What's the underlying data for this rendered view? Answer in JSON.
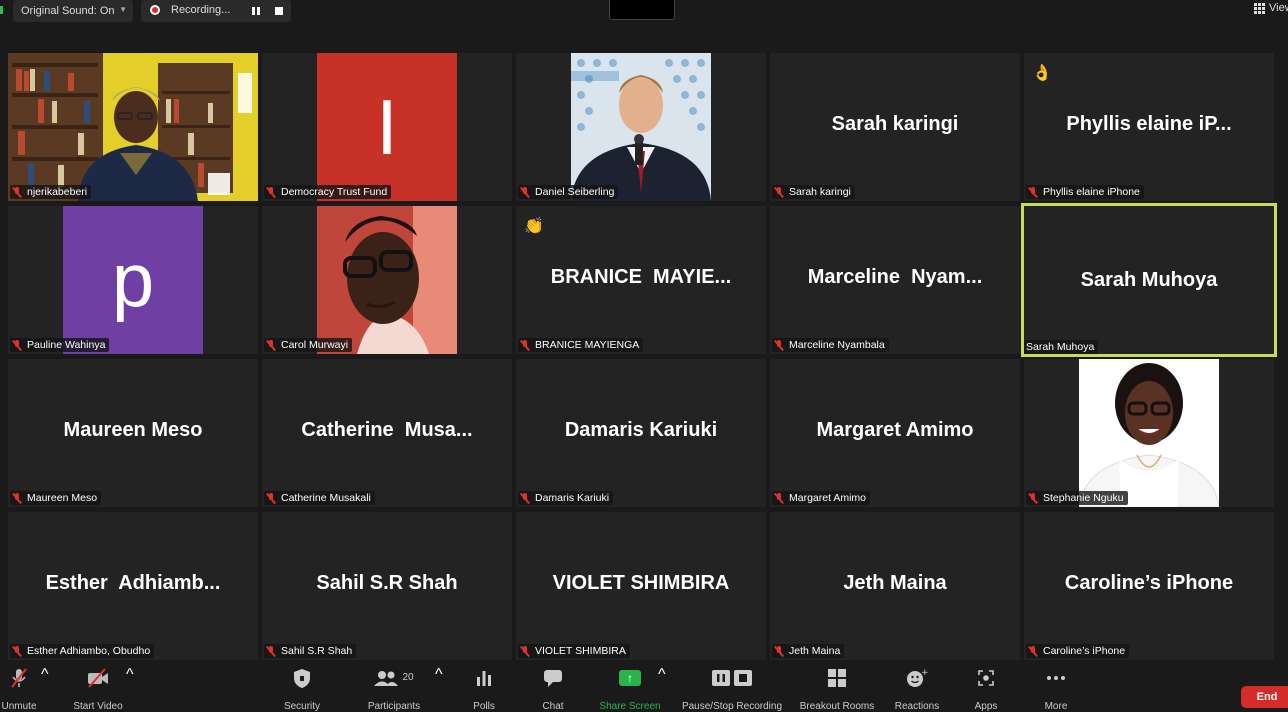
{
  "topbar": {
    "original_sound": "Original Sound: On",
    "recording": "Recording...",
    "view": "View"
  },
  "tiles": [
    {
      "label": "njerikabeberi",
      "big": ""
    },
    {
      "label": "Democracy Trust Fund",
      "big": "",
      "avatar_letter": "I"
    },
    {
      "label": "Daniel Seiberling",
      "big": ""
    },
    {
      "label": "Sarah karingi",
      "big": "Sarah karingi"
    },
    {
      "label": "Phyllis elaine iPhone",
      "big": "Phyllis elaine iP...",
      "emoji": "👌"
    },
    {
      "label": "Pauline Wahinya",
      "big": "",
      "avatar_letter": "p"
    },
    {
      "label": "Carol Murwayi",
      "big": ""
    },
    {
      "label": "BRANICE MAYIENGA",
      "big": "BRANICE  MAYIE...",
      "emoji": "👏"
    },
    {
      "label": "Marceline Nyambala",
      "big": "Marceline  Nyam..."
    },
    {
      "label": "Sarah Muhoya",
      "big": "Sarah Muhoya"
    },
    {
      "label": "Maureen Meso",
      "big": "Maureen Meso"
    },
    {
      "label": "Catherine Musakali",
      "big": "Catherine  Musa..."
    },
    {
      "label": "Damaris Kariuki",
      "big": "Damaris Kariuki"
    },
    {
      "label": "Margaret Amimo",
      "big": "Margaret Amimo"
    },
    {
      "label": "Stephanie Nguku",
      "big": ""
    },
    {
      "label": "Esther Adhiambo, Obudho",
      "big": "Esther  Adhiamb..."
    },
    {
      "label": "Sahil S.R Shah",
      "big": "Sahil S.R Shah"
    },
    {
      "label": "VIOLET SHIMBIRA",
      "big": "VIOLET SHIMBIRA"
    },
    {
      "label": "Jeth Maina",
      "big": "Jeth Maina"
    },
    {
      "label": "Caroline’s iPhone",
      "big": "Caroline’s iPhone"
    }
  ],
  "toolbar": {
    "unmute": "Unmute",
    "start_video": "Start Video",
    "security": "Security",
    "participants": "Participants",
    "participants_count": "20",
    "polls": "Polls",
    "chat": "Chat",
    "share_screen": "Share Screen",
    "pause_stop_recording": "Pause/Stop Recording",
    "breakout_rooms": "Breakout Rooms",
    "reactions": "Reactions",
    "apps": "Apps",
    "more": "More",
    "end": "End"
  },
  "colors": {
    "active_speaker_border": "#c6dd5a",
    "mic_muted": "#e0322b",
    "share_green": "#2bb24a",
    "end_red": "#d42b2b"
  }
}
